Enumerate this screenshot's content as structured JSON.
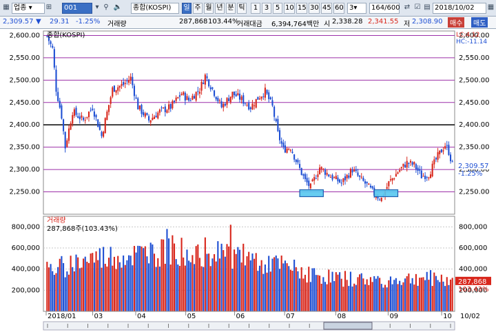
{
  "toolbar": {
    "market": "업종",
    "code": "001",
    "name": "종합(KOSPI)",
    "periods": [
      "일",
      "주",
      "월",
      "년",
      "분",
      "틱"
    ],
    "selected_period": "일",
    "minute_options": [
      "1",
      "3",
      "5",
      "10",
      "15",
      "30",
      "45",
      "60"
    ],
    "step": "3",
    "count": "164",
    "count_total": "/600",
    "date": "2018/10/02"
  },
  "quote": {
    "price": "2,309.57",
    "direction": "▼",
    "change": "29.31",
    "change_pct": "-1.25%",
    "volume_label": "거래량",
    "volume": "287,868",
    "volume_ratio": "103.44%",
    "amount_label": "거래대금",
    "amount": "6,394,764백만",
    "open_label": "시",
    "open": "2,338.28",
    "high": "2,341.55",
    "low_label": "저",
    "low": "2,308.90",
    "buy_label": "매수",
    "sell_label": "매도"
  },
  "colors": {
    "up": "#d8261b",
    "down": "#1e4fd3",
    "guide": "#9b2fa8",
    "support_box": "#56c8f0"
  },
  "chart_data": [
    {
      "type": "candlestick",
      "title": "종합(KOSPI)",
      "ylim": [
        2200,
        2610
      ],
      "y_ticks": [
        "2,600.00",
        "2,550.00",
        "2,500.00",
        "2,450.00",
        "2,400.00",
        "2,350.00",
        "2,300.00",
        "2,250.00"
      ],
      "top_right_labels": [
        "LC:4.12",
        "HC:-11.14"
      ],
      "horizontal_lines": [
        2600,
        2550,
        2500,
        2450,
        2400,
        2350,
        2300,
        2250
      ],
      "bold_line": 2400,
      "last_price": "2,309.57",
      "last_change": "-1.25%",
      "support_boxes": [
        {
          "period": "07",
          "level": 2247
        },
        {
          "period": "08",
          "level": 2247
        }
      ],
      "anchors": [
        [
          0,
          2598
        ],
        [
          3,
          2570
        ],
        [
          5,
          2480
        ],
        [
          8,
          2420
        ],
        [
          10,
          2350
        ],
        [
          14,
          2430
        ],
        [
          20,
          2410
        ],
        [
          25,
          2440
        ],
        [
          30,
          2375
        ],
        [
          36,
          2480
        ],
        [
          42,
          2490
        ],
        [
          46,
          2505
        ],
        [
          50,
          2440
        ],
        [
          56,
          2410
        ],
        [
          62,
          2430
        ],
        [
          68,
          2440
        ],
        [
          74,
          2470
        ],
        [
          78,
          2455
        ],
        [
          84,
          2480
        ],
        [
          87,
          2510
        ],
        [
          91,
          2480
        ],
        [
          96,
          2440
        ],
        [
          102,
          2470
        ],
        [
          106,
          2460
        ],
        [
          112,
          2440
        ],
        [
          116,
          2460
        ],
        [
          120,
          2475
        ],
        [
          124,
          2440
        ],
        [
          127,
          2380
        ],
        [
          130,
          2345
        ],
        [
          134,
          2350
        ],
        [
          138,
          2310
        ],
        [
          142,
          2275
        ],
        [
          145,
          2260
        ],
        [
          150,
          2305
        ],
        [
          156,
          2285
        ],
        [
          162,
          2270
        ],
        [
          168,
          2300
        ],
        [
          172,
          2280
        ],
        [
          176,
          2265
        ],
        [
          180,
          2245
        ],
        [
          184,
          2235
        ],
        [
          188,
          2270
        ],
        [
          193,
          2295
        ],
        [
          198,
          2315
        ],
        [
          202,
          2310
        ],
        [
          206,
          2285
        ],
        [
          210,
          2290
        ],
        [
          215,
          2330
        ],
        [
          219,
          2355
        ],
        [
          221,
          2340
        ],
        [
          223,
          2310
        ]
      ]
    },
    {
      "type": "bar",
      "title": "거래량",
      "subtitle": "287,868주(103.43%)",
      "ylim": [
        0,
        900000
      ],
      "y_ticks": [
        "800,000",
        "600,000",
        "400,000",
        "200,000"
      ],
      "last_value": "287,868",
      "last_pct": "103.43%",
      "level_anchors": [
        [
          0,
          380000
        ],
        [
          10,
          430000
        ],
        [
          25,
          500000
        ],
        [
          45,
          520000
        ],
        [
          70,
          560000
        ],
        [
          90,
          560000
        ],
        [
          105,
          520000
        ],
        [
          118,
          470000
        ],
        [
          130,
          420000
        ],
        [
          150,
          330000
        ],
        [
          170,
          300000
        ],
        [
          190,
          290000
        ],
        [
          210,
          320000
        ],
        [
          223,
          290000
        ]
      ],
      "tallest": [
        [
          101,
          820000
        ],
        [
          66,
          780000
        ],
        [
          64,
          680000
        ],
        [
          69,
          720000
        ],
        [
          87,
          700000
        ],
        [
          57,
          650000
        ],
        [
          96,
          640000
        ],
        [
          108,
          640000
        ]
      ]
    }
  ],
  "x_axis": {
    "labels": [
      "2018/01",
      "03",
      "04",
      "05",
      "06",
      "07",
      "08",
      "09",
      "10",
      "10/02"
    ],
    "slider_ticks": 20
  }
}
